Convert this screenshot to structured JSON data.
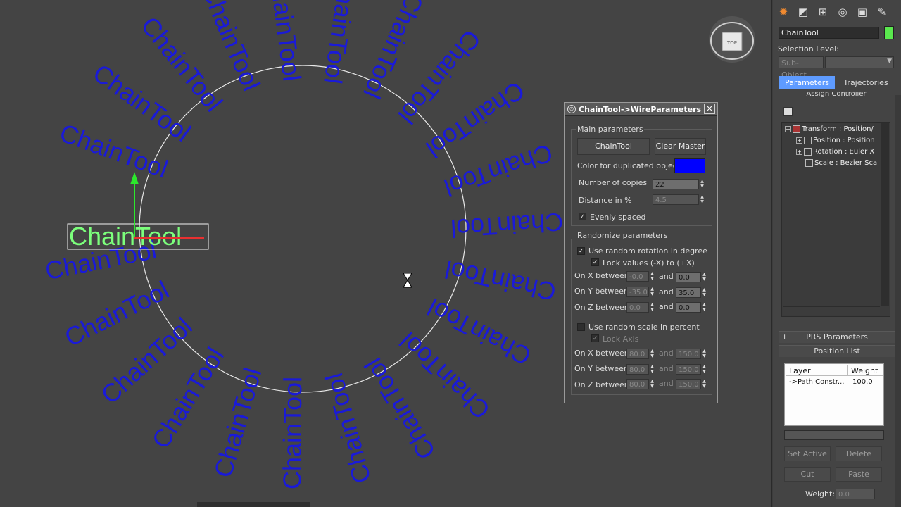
{
  "viewport": {
    "copy_text": "ChainTool",
    "copy_color": "#1a1ad8",
    "selected_color": "#7cff7c",
    "viewcube_label": "TOP"
  },
  "dialog": {
    "title": "ChainTool->WireParameters",
    "close_label": "✕",
    "main_group": "Main parameters",
    "chaintool_button": "ChainTool",
    "clear_master_button": "Clear Master",
    "color_label": "Color for duplicated objects",
    "color_value": "#0000ff",
    "copies_label": "Number of copies",
    "copies_value": "22",
    "distance_label": "Distance in %",
    "distance_value": "4.5",
    "evenly_label": "Evenly spaced",
    "randomize_group": "Randomize parameters",
    "random_rotation_label": "Use random rotation in degree",
    "lock_values_label": "Lock values (-X) to (+X)",
    "rot_x_label": "On X between",
    "rot_x_min": "-0.0",
    "rot_x_max": "0.0",
    "rot_y_label": "On Y between",
    "rot_y_min": "-35.0",
    "rot_y_max": "35.0",
    "rot_z_label": "On Z between",
    "rot_z_min": "0.0",
    "rot_z_max": "0.0",
    "and_label": "and",
    "random_scale_label": "Use random scale in percent",
    "lock_axis_label": "Lock Axis",
    "scale_x_label": "On X between",
    "scale_x_min": "80.0",
    "scale_x_max": "150.0",
    "scale_y_label": "On Y between",
    "scale_y_min": "80.0",
    "scale_y_max": "150.0",
    "scale_z_label": "On Z between",
    "scale_z_min": "80.0",
    "scale_z_max": "150.0"
  },
  "command_panel": {
    "object_name": "ChainTool",
    "object_color": "#5ae84e",
    "selection_level_label": "Selection Level:",
    "sub_object_label": "Sub-Object",
    "parameters_tab": "Parameters",
    "trajectories_tab": "Trajectories",
    "assign_controller_title": "Assign Controller",
    "tree": {
      "transform": "Transform : Position/",
      "position": "Position : Position",
      "rotation": "Rotation : Euler X",
      "scale": "Scale : Bezier Sca"
    },
    "prs_rollout": "PRS Parameters",
    "position_list_rollout": "Position List",
    "layer_header": "Layer",
    "weight_header": "Weight",
    "layer_name": "->Path Constr...",
    "layer_weight": "100.0",
    "set_active_button": "Set Active",
    "delete_button": "Delete",
    "cut_button": "Cut",
    "paste_button": "Paste",
    "weight_label": "Weight:",
    "weight_value": "0.0"
  }
}
